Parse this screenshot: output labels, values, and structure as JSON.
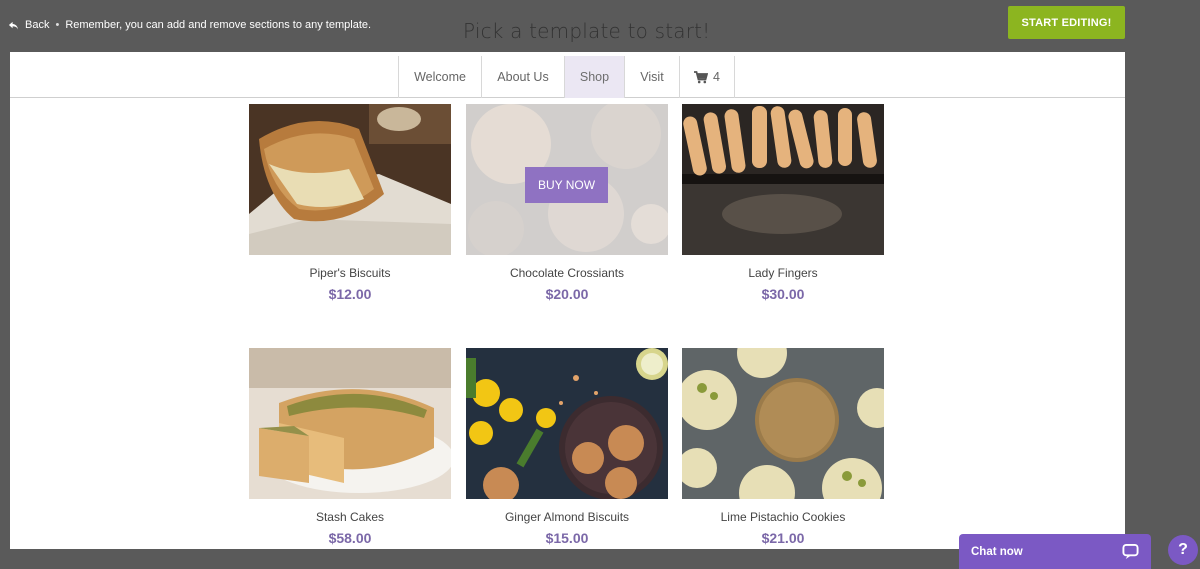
{
  "topbar": {
    "back_label": "Back",
    "separator": "•",
    "hint": "Remember, you can add and remove sections to any template.",
    "title": "Pick a template to start!",
    "start_label": "START EDITING!"
  },
  "nav": {
    "tabs": [
      {
        "label": "Welcome"
      },
      {
        "label": "About Us"
      },
      {
        "label": "Shop"
      },
      {
        "label": "Visit"
      }
    ],
    "cart_count": "4"
  },
  "products": [
    {
      "name": "Piper's Biscuits",
      "price": "$12.00"
    },
    {
      "name": "Chocolate Crossiants",
      "price": "$20.00",
      "buy_label": "BUY NOW"
    },
    {
      "name": "Lady Fingers",
      "price": "$30.00"
    },
    {
      "name": "Stash Cakes",
      "price": "$58.00"
    },
    {
      "name": "Ginger Almond Biscuits",
      "price": "$15.00"
    },
    {
      "name": "Lime Pistachio Cookies",
      "price": "$21.00"
    }
  ],
  "chat": {
    "label": "Chat now"
  },
  "help": {
    "label": "?"
  },
  "colors": {
    "accent": "#7b59c4",
    "start_button": "#8cb520",
    "price": "#7b68a8",
    "background": "#5a5a5a"
  },
  "icons": [
    "back-arrow-icon",
    "cart-icon",
    "chat-bubble-icon",
    "help-icon"
  ]
}
